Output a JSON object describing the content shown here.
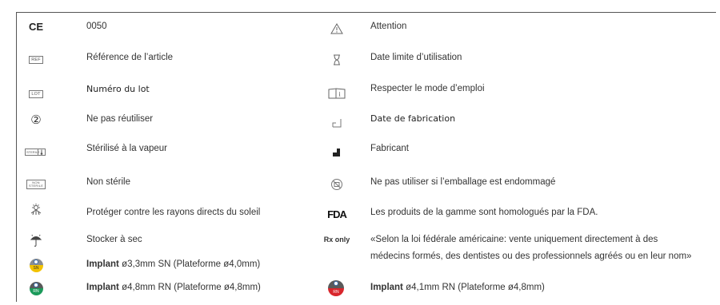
{
  "left": [
    {
      "symbol": "CE",
      "text": "0050"
    },
    {
      "symbol": "REF",
      "text": "Référence de l’article"
    },
    {
      "symbol": "LOT",
      "text": "Numéro du lot"
    },
    {
      "symbol": "②",
      "text": "Ne pas réutiliser"
    },
    {
      "symbol": "STERILE",
      "text": "Stérilisé à la vapeur"
    },
    {
      "symbol": "NON STERILE",
      "text": "Non stérile"
    },
    {
      "symbol": "sun-protect-icon",
      "text": "Protéger contre les rayons directs du soleil"
    },
    {
      "symbol": "umbrella-icon",
      "text": "Stocker à sec"
    },
    {
      "badge": "SN",
      "bold": "Implant",
      "text": " ø3,3mm SN (Plateforme ø4,0mm)"
    },
    {
      "badge": "RN",
      "bold": "Implant",
      "text": " ø4,8mm RN (Plateforme ø4,8mm)"
    }
  ],
  "right": [
    {
      "symbol": "warning-icon",
      "text": "Attention"
    },
    {
      "symbol": "hourglass-icon",
      "text": "Date limite d’utilisation"
    },
    {
      "symbol": "book-info-icon",
      "text": "Respecter le mode d’emploi"
    },
    {
      "symbol": "factory-outline-icon",
      "text": "Date de fabrication"
    },
    {
      "symbol": "factory-filled-icon",
      "text": "Fabricant"
    },
    {
      "symbol": "damaged-package-icon",
      "text": "Ne pas utiliser si l’emballage est endommagé"
    },
    {
      "symbol": "FDA",
      "text": "Les produits de la gamme sont homologués par la FDA."
    },
    {
      "symbol": "Rx only",
      "text_line1": "«Selon la loi fédérale américaine: vente uniquement directement à des",
      "text_line2": "médecins formés, des dentistes ou des professionnels agréés ou en leur nom»"
    },
    {
      "badge": "RN",
      "bold": "Implant",
      "text": " ø4,1mm RN (Plateforme ø4,8mm)"
    }
  ],
  "colors": {
    "sn_yellow": "#f2c200",
    "rn_green": "#1b9a5a",
    "rn_red": "#d8262c",
    "top_gray": "#8a8d91",
    "rn_dark": "#5a5a5a"
  }
}
